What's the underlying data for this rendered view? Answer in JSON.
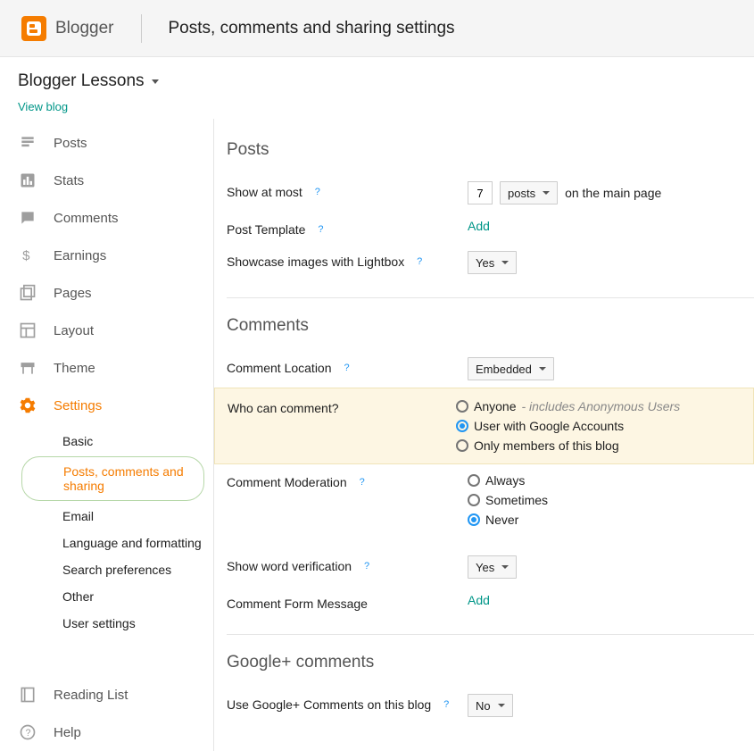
{
  "header": {
    "brand": "Blogger",
    "title": "Posts, comments and sharing settings"
  },
  "blog_selector": "Blogger Lessons",
  "view_blog": "View blog",
  "nav": {
    "posts": "Posts",
    "stats": "Stats",
    "comments": "Comments",
    "earnings": "Earnings",
    "pages": "Pages",
    "layout": "Layout",
    "theme": "Theme",
    "settings": "Settings",
    "reading_list": "Reading List",
    "help": "Help"
  },
  "sub": {
    "basic": "Basic",
    "posts_comments_sharing": "Posts, comments and sharing",
    "email": "Email",
    "language": "Language and formatting",
    "search": "Search preferences",
    "other": "Other",
    "user": "User settings"
  },
  "posts_section": {
    "title": "Posts",
    "show_at_most": "Show at most",
    "count": "7",
    "unit": "posts",
    "suffix": "on the main page",
    "post_template": "Post Template",
    "add": "Add",
    "lightbox": "Showcase images with Lightbox",
    "lightbox_value": "Yes"
  },
  "comments_section": {
    "title": "Comments",
    "location": "Comment Location",
    "location_value": "Embedded",
    "who_can": "Who can comment?",
    "opt_anyone": "Anyone",
    "opt_anyone_hint": " - includes Anonymous Users",
    "opt_google": "User with Google Accounts",
    "opt_members": "Only members of this blog",
    "moderation": "Comment Moderation",
    "mod_always": "Always",
    "mod_sometimes": "Sometimes",
    "mod_never": "Never",
    "word_verif": "Show word verification",
    "word_verif_value": "Yes",
    "form_message": "Comment Form Message",
    "add": "Add"
  },
  "gplus_section": {
    "title": "Google+ comments",
    "use_gplus": "Use Google+ Comments on this blog",
    "value": "No"
  },
  "help_q": "?"
}
